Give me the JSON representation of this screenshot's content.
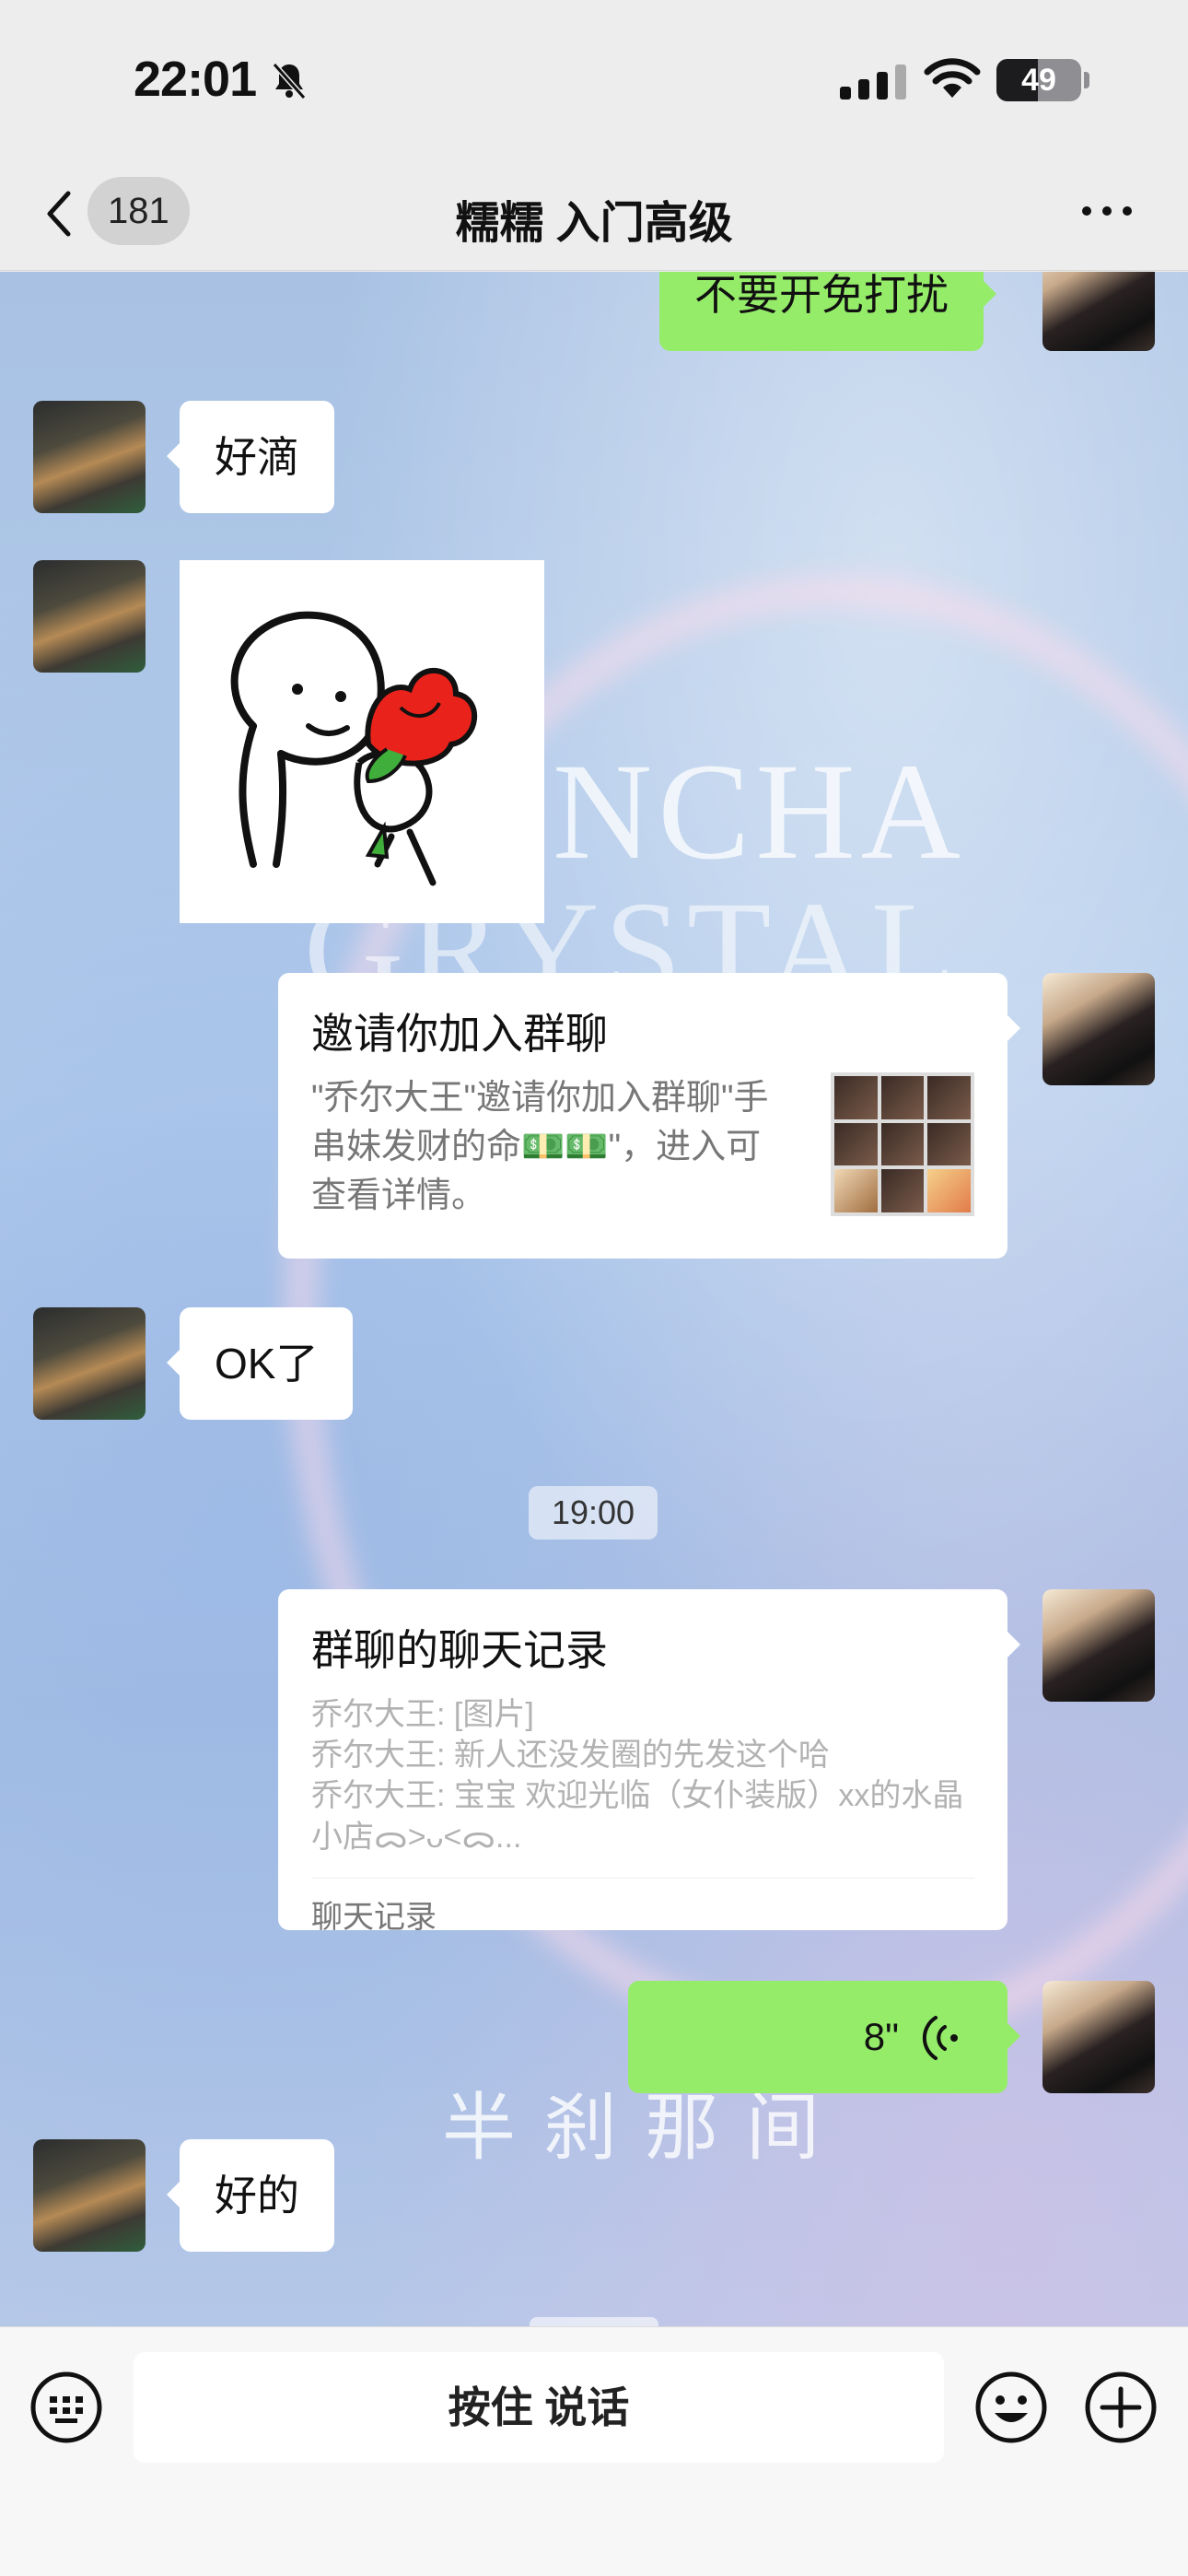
{
  "status_bar": {
    "time": "22:01",
    "battery": "49",
    "battery_level": 0.49
  },
  "nav": {
    "back_count": "181",
    "title": "糯糯 入门高级"
  },
  "wallpaper": {
    "line1": "NCHA",
    "line2": "GRYSTAL",
    "bottom_text": "半刹那间"
  },
  "messages": {
    "m0": "不要开免打扰",
    "m1": "好滴",
    "m3": "OK了",
    "m6": "好的"
  },
  "invite_card": {
    "title": "邀请你加入群聊",
    "description": "\"乔尔大王\"邀请你加入群聊\"手串妹发财的命💵💵\"，进入可查看详情。"
  },
  "timestamp": "19:00",
  "record_card": {
    "title": "群聊的聊天记录",
    "line1": "乔尔大王: [图片]",
    "line2": "乔尔大王: 新人还没发圈的先发这个哈",
    "line3": "乔尔大王: 宝宝 欢迎光临（女仆装版）xx的水晶小店ᯅ>ᴗ<ᯅ...",
    "footer": "聊天记录"
  },
  "voice": {
    "duration": "8\""
  },
  "input_bar": {
    "hold_to_talk": "按住 说话"
  }
}
